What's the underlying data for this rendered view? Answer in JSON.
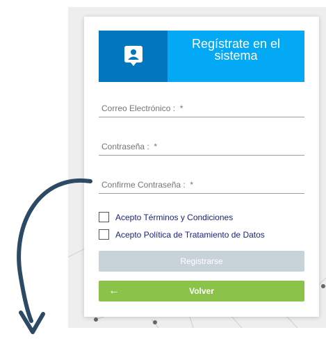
{
  "header": {
    "title": "Regístrate en el sistema",
    "icon": "user-badge-icon"
  },
  "fields": [
    {
      "placeholder": "Correo Electrónico :  *",
      "value": ""
    },
    {
      "placeholder": "Contraseña :  *",
      "value": ""
    },
    {
      "placeholder": "Confirme Contraseña :  *",
      "value": ""
    }
  ],
  "checkboxes": [
    {
      "label": "Acepto Términos y Condiciones",
      "checked": false
    },
    {
      "label": "Acepto Política de Tratamiento de Datos",
      "checked": false
    }
  ],
  "buttons": {
    "register": "Registrarse",
    "back": "Volver",
    "back_arrow": "←"
  },
  "colors": {
    "header_light": "#03a9f4",
    "header_dark": "#0277bd",
    "register_disabled": "#c8d3d9",
    "back_green": "#8bc34a",
    "arrow_navy": "#2c4a63"
  }
}
